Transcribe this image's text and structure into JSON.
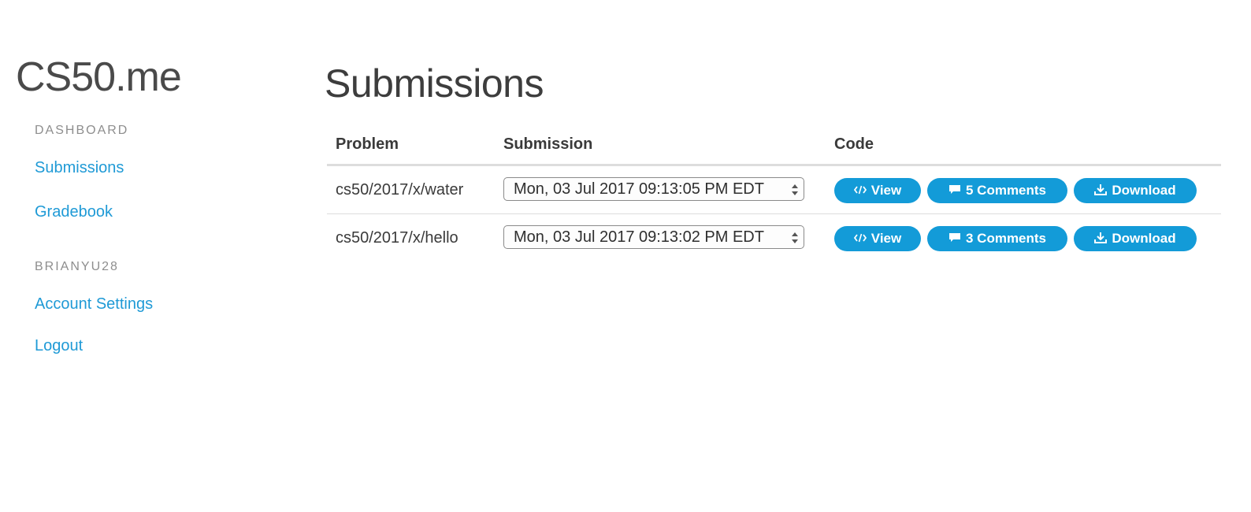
{
  "sidebar": {
    "brand": "CS50.me",
    "sections": [
      {
        "heading": "DASHBOARD",
        "links": [
          "Submissions",
          "Gradebook"
        ]
      },
      {
        "heading": "BRIANYU28",
        "links": [
          "Account Settings",
          "Logout"
        ]
      }
    ]
  },
  "main": {
    "title": "Submissions",
    "table": {
      "headers": [
        "Problem",
        "Submission",
        "Code"
      ],
      "rows": [
        {
          "problem": "cs50/2017/x/water",
          "submission": "Mon, 03 Jul 2017 09:13:05 PM EDT",
          "view_label": "View",
          "comments_label": "5 Comments",
          "download_label": "Download"
        },
        {
          "problem": "cs50/2017/x/hello",
          "submission": "Mon, 03 Jul 2017 09:13:02 PM EDT",
          "view_label": "View",
          "comments_label": "3 Comments",
          "download_label": "Download"
        }
      ]
    }
  },
  "icons": {
    "view": "code-icon",
    "comments": "comment-icon",
    "download": "download-icon"
  },
  "colors": {
    "accent": "#1f9ad6",
    "button": "#139bd8",
    "muted": "#8e8e8e"
  }
}
